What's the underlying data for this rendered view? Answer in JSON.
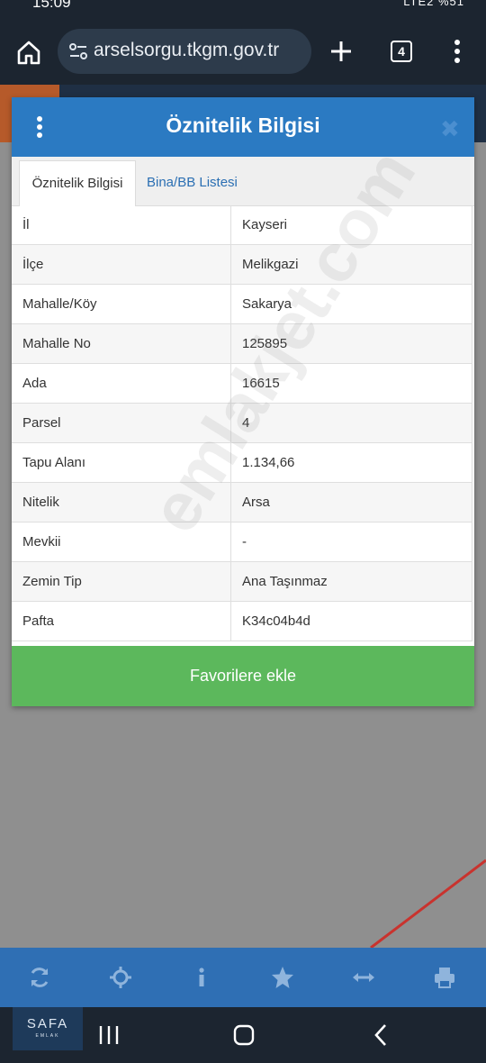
{
  "status_bar": {
    "time": "15:09",
    "indicators": "LTE2 %51"
  },
  "browser": {
    "url": "arselsorgu.tkgm.gov.tr",
    "tab_count": "4",
    "icons": [
      "home-icon",
      "site-settings-icon",
      "plus-icon",
      "tabs-icon",
      "more-vert-icon"
    ]
  },
  "dialog": {
    "title": "Öznitelik Bilgisi",
    "close_glyph": "✖",
    "tabs": [
      {
        "label": "Öznitelik Bilgisi",
        "active": true
      },
      {
        "label": "Bina/BB Listesi",
        "active": false
      }
    ],
    "rows": [
      {
        "key": "İl",
        "value": "Kayseri"
      },
      {
        "key": "İlçe",
        "value": "Melikgazi"
      },
      {
        "key": "Mahalle/Köy",
        "value": "Sakarya"
      },
      {
        "key": "Mahalle No",
        "value": "125895"
      },
      {
        "key": "Ada",
        "value": "16615"
      },
      {
        "key": "Parsel",
        "value": "4"
      },
      {
        "key": "Tapu Alanı",
        "value": "1.134,66"
      },
      {
        "key": "Nitelik",
        "value": "Arsa"
      },
      {
        "key": "Mevkii",
        "value": "-"
      },
      {
        "key": "Zemin Tip",
        "value": "Ana Taşınmaz"
      },
      {
        "key": "Pafta",
        "value": "K34c04b4d"
      }
    ],
    "favorite_button": "Favorilere ekle"
  },
  "watermark": "emlakjet.com",
  "toolbar": {
    "icons": [
      "refresh-icon",
      "locate-icon",
      "info-icon",
      "star-icon",
      "measure-icon",
      "print-icon"
    ]
  },
  "logo": {
    "main": "SAFA",
    "sub": "EMLAK"
  },
  "colors": {
    "header_blue": "#2b7ac2",
    "favorite_green": "#5cb85c",
    "toolbar_blue": "#2f6fb4",
    "system_bar": "#1c2530"
  }
}
